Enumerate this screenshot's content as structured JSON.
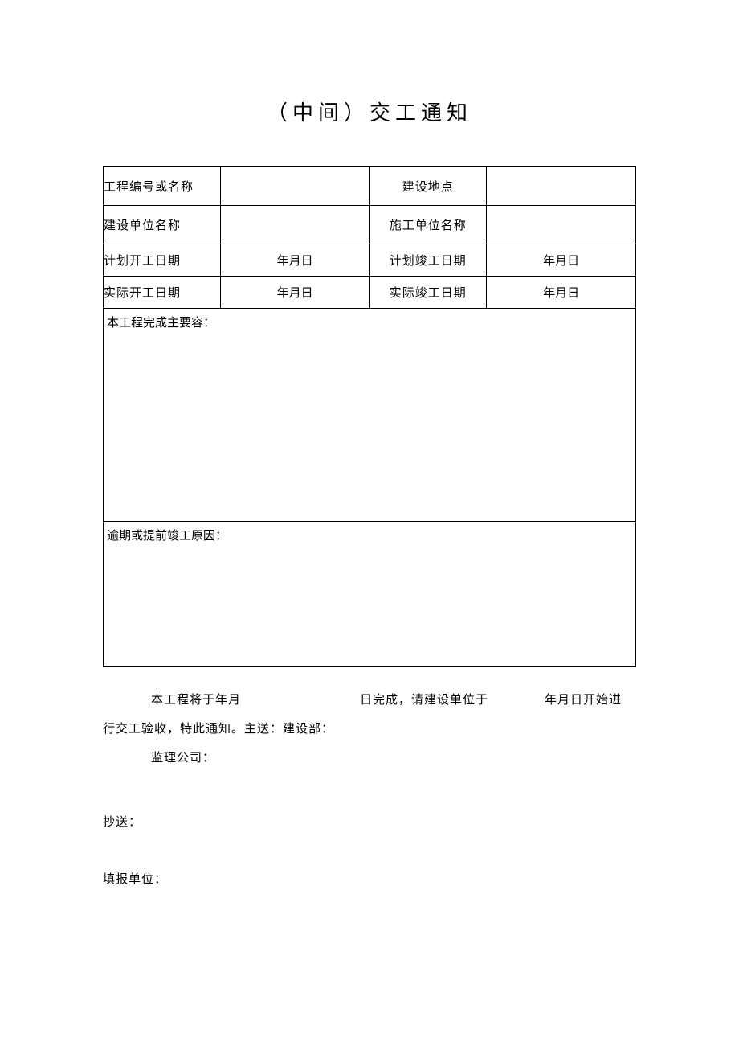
{
  "title": "（中间）交工通知",
  "table": {
    "row1": {
      "label1": "工程编号或名称",
      "value1": "",
      "label2": "建设地点",
      "value2": ""
    },
    "row2": {
      "label1": "建设单位名称",
      "value1": "",
      "label2": "施工单位名称",
      "value2": ""
    },
    "row3": {
      "label1": "计划开工日期",
      "value1": "年月日",
      "label2": "计划竣工日期",
      "value2": "年月日"
    },
    "row4": {
      "label1": "实际开工日期",
      "value1": "年月日",
      "label2": "实际竣工日期",
      "value2": "年月日"
    },
    "section1_label": "本工程完成主要容：",
    "section2_label": "逾期或提前竣工原因："
  },
  "body": {
    "line1_seg1": "本工程将于年月",
    "line1_seg2": "日完成，请建设单位于",
    "line1_seg3": "年月日开始进",
    "line2": "行交工验收，特此通知。主送：建设部：",
    "line3": "监理公司："
  },
  "footer": {
    "cc": "抄送：",
    "reporter": "填报单位："
  }
}
